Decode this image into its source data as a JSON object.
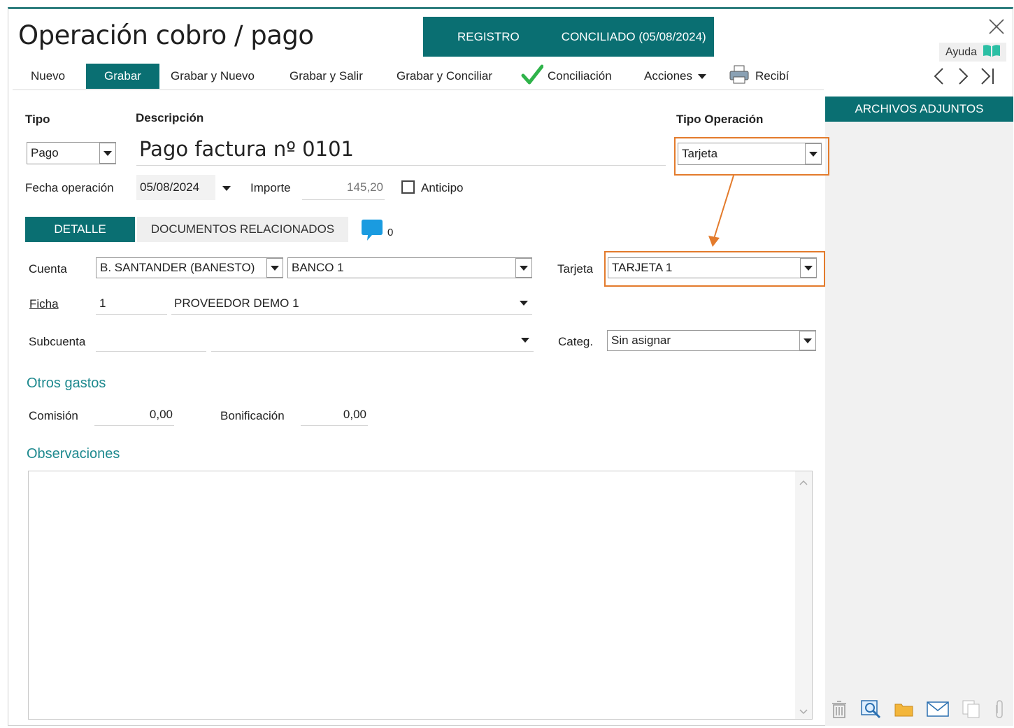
{
  "window": {
    "title": "Operación cobro / pago",
    "status_registro": "REGISTRO",
    "status_conciliado": "CONCILIADO (05/08/2024)",
    "help_label": "Ayuda"
  },
  "toolbar": {
    "nuevo": "Nuevo",
    "grabar": "Grabar",
    "grabar_nuevo": "Grabar y Nuevo",
    "grabar_salir": "Grabar y Salir",
    "grabar_conciliar": "Grabar y Conciliar",
    "conciliacion": "Conciliación",
    "acciones": "Acciones",
    "recibi": "Recibí"
  },
  "side_panel": {
    "title": "ARCHIVOS ADJUNTOS"
  },
  "form": {
    "tipo_label": "Tipo",
    "tipo_value": "Pago",
    "descripcion_label": "Descripción",
    "descripcion_value": "Pago factura nº 0101",
    "tipo_operacion_label": "Tipo Operación",
    "tipo_operacion_value": "Tarjeta",
    "fecha_label": "Fecha operación",
    "fecha_value": "05/08/2024",
    "importe_label": "Importe",
    "importe_value": "145,20",
    "anticipo_label": "Anticipo",
    "anticipo_checked": false
  },
  "tabs": {
    "detalle": "DETALLE",
    "documentos": "DOCUMENTOS RELACIONADOS",
    "comments_count": "0"
  },
  "detalle": {
    "cuenta_label": "Cuenta",
    "cuenta_banco": "B. SANTANDER (BANESTO)",
    "cuenta_nombre": "BANCO 1",
    "tarjeta_label": "Tarjeta",
    "tarjeta_value": "TARJETA 1",
    "ficha_label": "Ficha",
    "ficha_code": "1",
    "ficha_name": "PROVEEDOR DEMO 1",
    "subcuenta_label": "Subcuenta",
    "subcuenta_code": "",
    "subcuenta_name": "",
    "categ_label": "Categ.",
    "categ_value": "Sin asignar"
  },
  "otros_gastos": {
    "title": "Otros gastos",
    "comision_label": "Comisión",
    "comision_value": "0,00",
    "bonificacion_label": "Bonificación",
    "bonificacion_value": "0,00"
  },
  "observaciones": {
    "title": "Observaciones",
    "value": ""
  },
  "colors": {
    "accent": "#0a6f72",
    "highlight": "#e37b2c",
    "section_text": "#1f8a8f",
    "check_green": "#2fb34a"
  }
}
